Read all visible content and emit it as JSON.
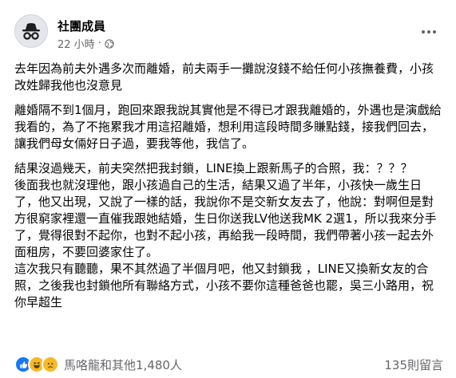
{
  "post": {
    "author": "社團成員",
    "timestamp": "22 小時",
    "audience_icon": "globe-icon",
    "menu_icon": "more-options-icon",
    "paragraphs": [
      "去年因為前夫外遇多次而離婚，前夫兩手一攤說沒錢不給任何小孩撫養費，小孩改姓歸我他也沒意見",
      "離婚隔不到1個月，跑回來跟我說其實他是不得已才跟我離婚的，外遇也是演戲給我看的，為了不拖累我才用這招離婚，想利用這段時間多賺點錢，接我們回去，讓我們母女倆好日子過，要我等他，我信了。",
      "結果沒過幾天，前夫突然把我封鎖，LINE換上跟新馬子的合照，我：？？？",
      "後面我也就沒理他，跟小孩過自己的生活，結果又過了半年，小孩快一歲生日了，他又出現，又說了一樣的話，我說你不是交新女友去了，他說：對啊但是對方很窮家裡還一直催我跟她結婚，生日你送我LV他送我MK 2選1，所以我來分手了，覺得很對不起你，也對不起小孩，再給我一段時間，我們帶著小孩一起去外面租房，不要回婆家住了。",
      "這次我只有聽聽，果不其然過了半個月吧，他又封鎖我 ，LINE又換新女友的合照，之後我也封鎖他所有聯絡方式，小孩不要你這種爸爸也罷，吳三小路用，祝你早超生"
    ]
  },
  "footer": {
    "reactions": [
      "like-reaction-icon",
      "haha-reaction-icon",
      "sad-reaction-icon"
    ],
    "reaction_summary": "馬咯龍和其他1,480人",
    "comment_count": "135則留言"
  },
  "colors": {
    "text": "#050505",
    "secondary_text": "#65676b",
    "like_blue": "#1877f2",
    "emoji_yellow": "#f7b928"
  }
}
